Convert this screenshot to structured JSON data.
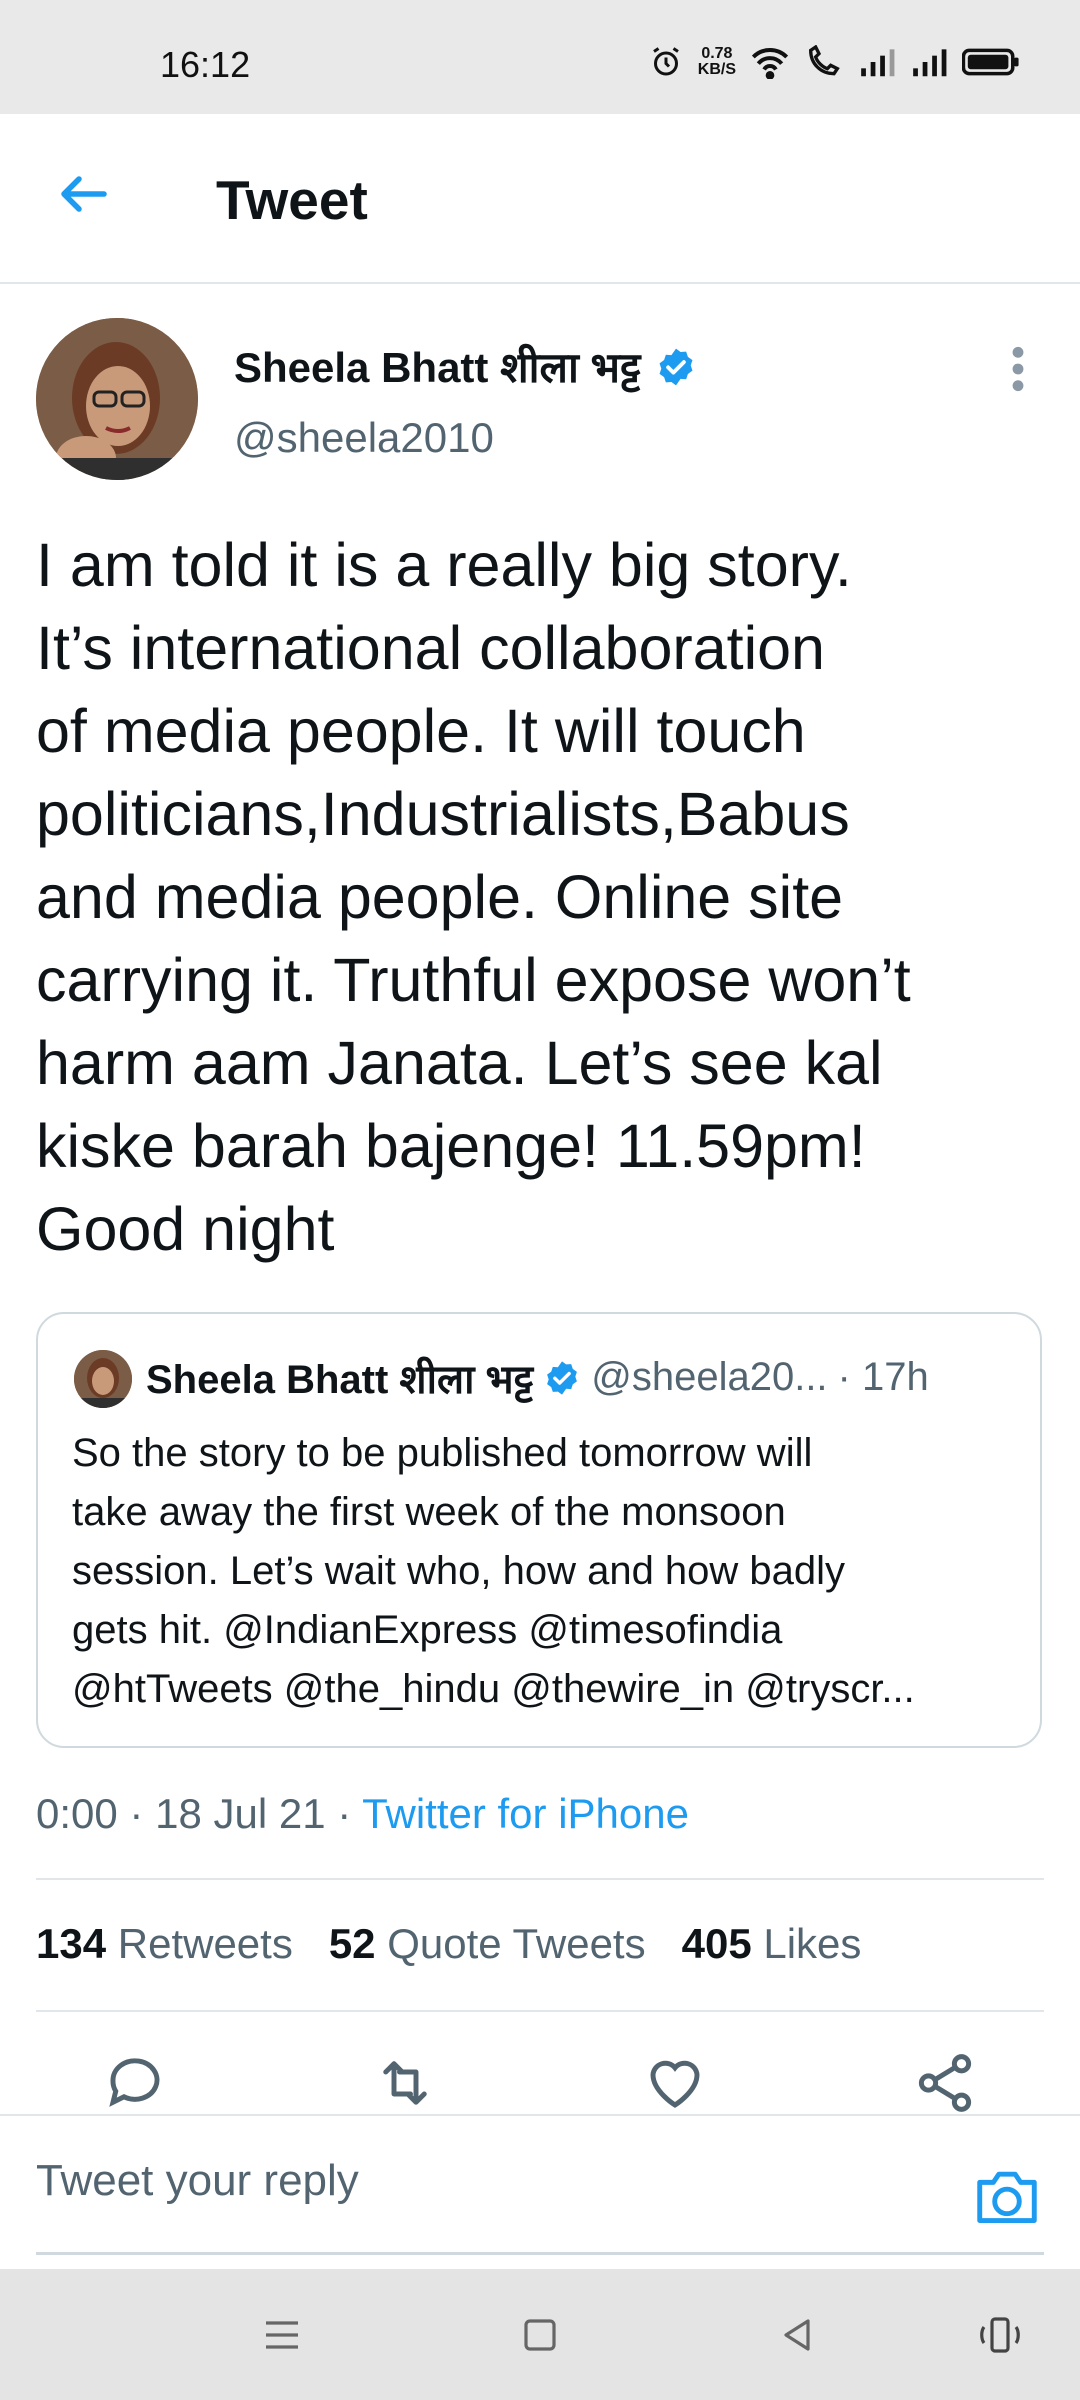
{
  "status_bar": {
    "time": "16:12",
    "net_speed_value": "0.78",
    "net_speed_unit": "KB/S",
    "icons": [
      "alarm-icon",
      "wifi-icon",
      "call-signal-icon",
      "signal-bars-icon",
      "signal-bars-icon",
      "battery-icon"
    ]
  },
  "header": {
    "title": "Tweet",
    "back_icon": "back-arrow-icon"
  },
  "tweet": {
    "author_name": "Sheela Bhatt शीला भट्ट",
    "author_handle": "@sheela2010",
    "verified_icon": "verified-badge-icon",
    "text": "I am told it is a really big story.\nIt’s international collaboration\nof media people. It will touch\npoliticians,Industrialists,Babus\nand media people. Online site\ncarrying it. Truthful expose won’t\nharm aam Janata. Let’s see kal\nkiske barah bajenge! 11.59pm!\nGood night",
    "time": "0:00",
    "date": "18 Jul 21",
    "source": "Twitter for iPhone"
  },
  "quoted_tweet": {
    "author_name": "Sheela Bhatt शीला भट्ट",
    "author_handle": "@sheela20...",
    "age": "· 17h",
    "text": "So the story to be published tomorrow will\ntake away the first week of the monsoon\nsession. Let’s wait who, how and how badly\ngets hit. @IndianExpress @timesofindia\n@htTweets @the_hindu @thewire_in @tryscr..."
  },
  "stats": {
    "retweets_count": "134",
    "retweets_label": "Retweets",
    "quotes_count": "52",
    "quotes_label": "Quote Tweets",
    "likes_count": "405",
    "likes_label": "Likes"
  },
  "actions": [
    "reply-icon",
    "retweet-icon",
    "like-icon",
    "share-icon"
  ],
  "reply": {
    "placeholder": "Tweet your reply",
    "camera_icon": "camera-icon"
  },
  "colors": {
    "accent": "#1d9bf0",
    "text": "#0f1419",
    "secondary": "#536471"
  }
}
